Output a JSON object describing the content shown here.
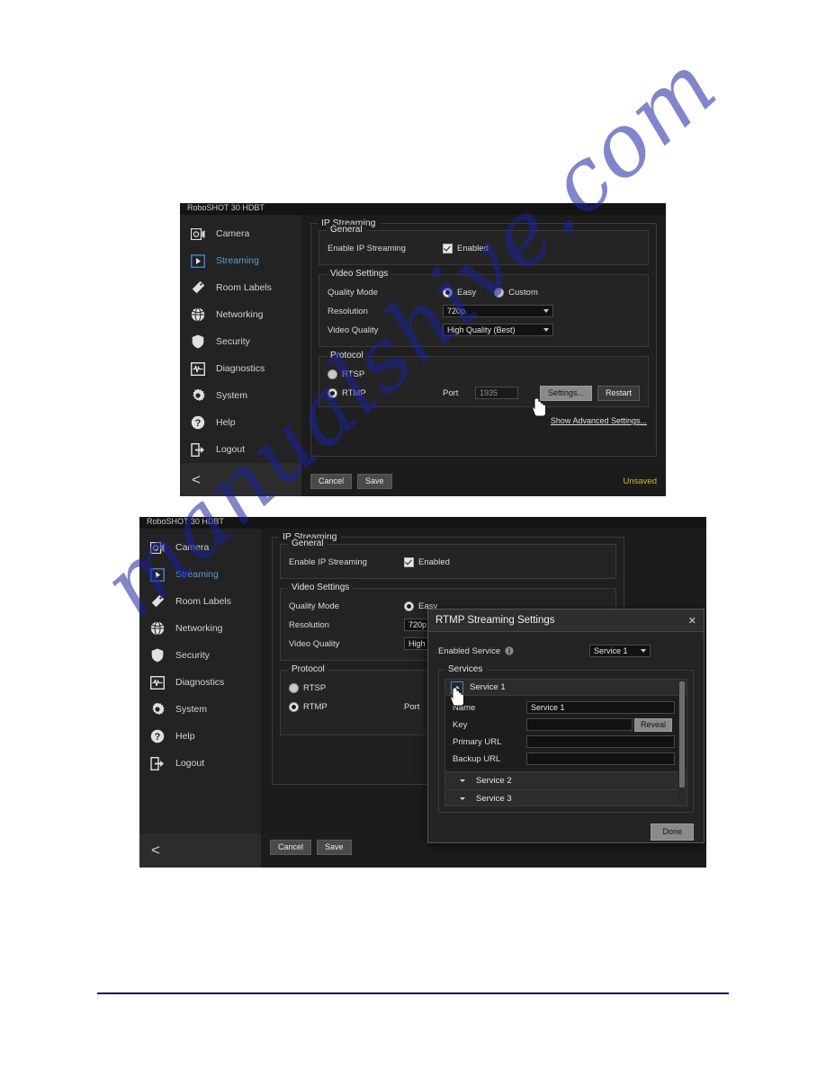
{
  "page": {
    "rule_color": "#002147",
    "watermark": "manualshive.com"
  },
  "panel_top": {
    "window_title": "RoboSHOT 30 HDBT",
    "sidebar": {
      "items": [
        {
          "label": "Camera",
          "icon": "camera-icon",
          "active": false
        },
        {
          "label": "Streaming",
          "icon": "play-icon",
          "active": true
        },
        {
          "label": "Room Labels",
          "icon": "tag-icon",
          "active": false
        },
        {
          "label": "Networking",
          "icon": "globe-icon",
          "active": false
        },
        {
          "label": "Security",
          "icon": "shield-icon",
          "active": false
        },
        {
          "label": "Diagnostics",
          "icon": "waveform-icon",
          "active": false
        },
        {
          "label": "System",
          "icon": "gear-icon",
          "active": false
        },
        {
          "label": "Help",
          "icon": "question-icon",
          "active": false
        },
        {
          "label": "Logout",
          "icon": "logout-icon",
          "active": false
        }
      ],
      "collapse_label": "<"
    },
    "content": {
      "title": "IP Streaming",
      "general": {
        "title": "General",
        "enable_label": "Enable IP Streaming",
        "enabled_text": "Enabled",
        "enabled_checked": true
      },
      "video_settings": {
        "title": "Video Settings",
        "quality_mode_label": "Quality Mode",
        "quality_mode_options": [
          "Easy",
          "Custom"
        ],
        "quality_mode_selected": "Easy",
        "resolution_label": "Resolution",
        "resolution_value": "720p",
        "video_quality_label": "Video Quality",
        "video_quality_value": "High Quality (Best)"
      },
      "protocol": {
        "title": "Protocol",
        "rtsp_label": "RTSP",
        "rtmp_label": "RTMP",
        "selected": "RTMP",
        "port_label": "Port",
        "port_value": "1935",
        "settings_button": "Settings...",
        "restart_button": "Restart",
        "advanced_link": "Show Advanced Settings..."
      },
      "footer": {
        "cancel": "Cancel",
        "save": "Save",
        "status": "Unsaved",
        "status_color": "#d9b521"
      }
    }
  },
  "panel_bottom": {
    "window_title": "RoboSHOT 30 HDBT",
    "sidebar": {
      "items": [
        {
          "label": "Camera",
          "icon": "camera-icon",
          "active": false
        },
        {
          "label": "Streaming",
          "icon": "play-icon",
          "active": true
        },
        {
          "label": "Room Labels",
          "icon": "tag-icon",
          "active": false
        },
        {
          "label": "Networking",
          "icon": "globe-icon",
          "active": false
        },
        {
          "label": "Security",
          "icon": "shield-icon",
          "active": false
        },
        {
          "label": "Diagnostics",
          "icon": "waveform-icon",
          "active": false
        },
        {
          "label": "System",
          "icon": "gear-icon",
          "active": false
        },
        {
          "label": "Help",
          "icon": "question-icon",
          "active": false
        },
        {
          "label": "Logout",
          "icon": "logout-icon",
          "active": false
        }
      ],
      "collapse_label": "<"
    },
    "content": {
      "title": "IP Streaming",
      "general": {
        "title": "General",
        "enable_label": "Enable IP Streaming",
        "enabled_text": "Enabled",
        "enabled_checked": true
      },
      "video_settings": {
        "title": "Video Settings",
        "quality_mode_label": "Quality Mode",
        "quality_mode_options": [
          "Easy"
        ],
        "quality_mode_selected": "Easy",
        "resolution_label": "Resolution",
        "resolution_value": "720p",
        "video_quality_label": "Video Quality",
        "video_quality_value": "High"
      },
      "protocol": {
        "title": "Protocol",
        "rtsp_label": "RTSP",
        "rtmp_label": "RTMP",
        "selected": "RTMP",
        "port_label": "Port"
      },
      "footer": {
        "cancel": "Cancel",
        "save": "Save"
      }
    },
    "dialog": {
      "title": "RTMP Streaming Settings",
      "close_icon": "close-icon",
      "enabled_service_label": "Enabled Service",
      "info_icon": "info-icon",
      "enabled_service_value": "Service 1",
      "services_group_title": "Services",
      "services": [
        {
          "name": "Service 1",
          "expanded": true,
          "fields": {
            "name_label": "Name",
            "name_value": "Service 1",
            "key_label": "Key",
            "key_value": "",
            "reveal_button": "Reveal",
            "primary_url_label": "Primary URL",
            "primary_url_value": "",
            "backup_url_label": "Backup URL",
            "backup_url_value": ""
          }
        },
        {
          "name": "Service 2",
          "expanded": false
        },
        {
          "name": "Service 3",
          "expanded": false
        }
      ],
      "done_button": "Done"
    }
  }
}
